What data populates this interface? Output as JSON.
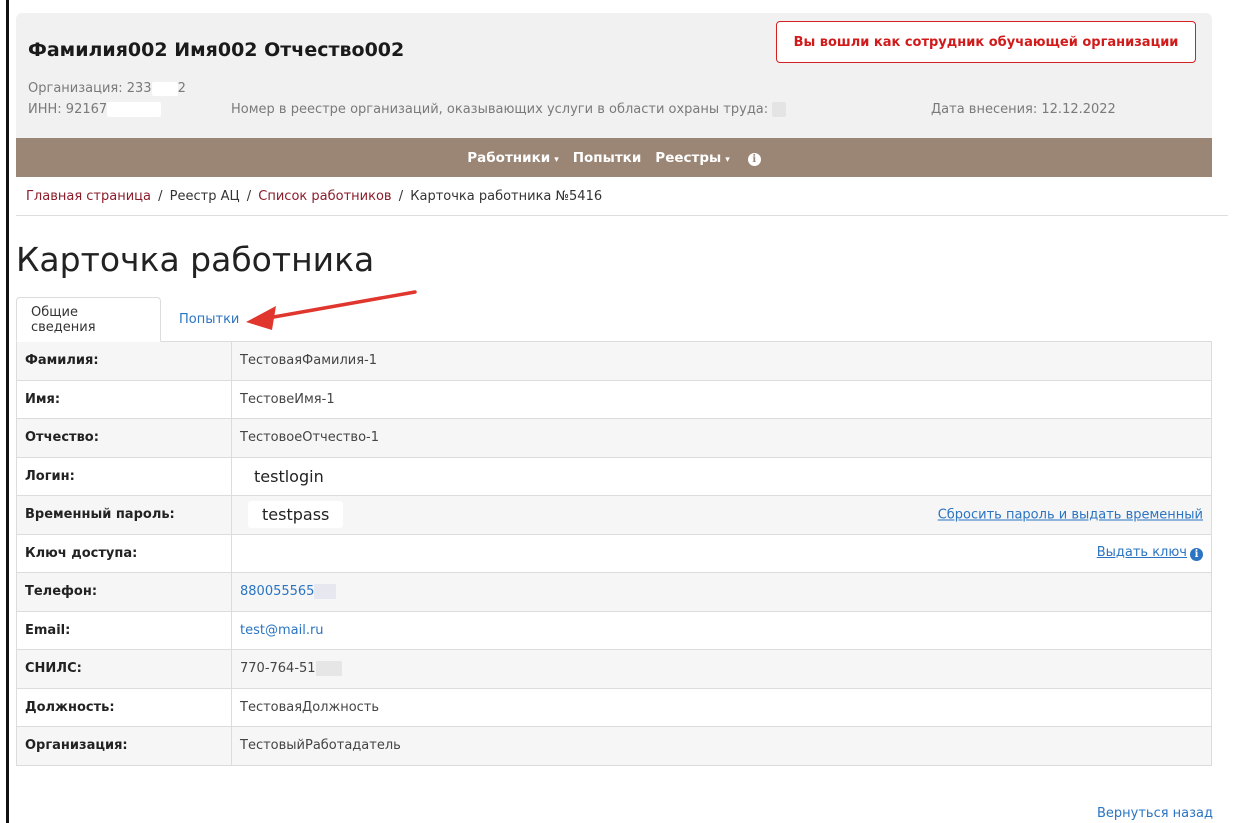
{
  "header": {
    "user_name": "Фамилия002 Имя002 Отчество002",
    "org_label": "Организация:",
    "org_value": "233",
    "org_tail": "2",
    "inn_label": "ИНН:",
    "inn_value": "92167",
    "reestr_label": "Номер в реестре организаций, оказывающих услуги в области охраны труда:",
    "date_label": "Дата внесения:",
    "date_value": "12.12.2022",
    "role_badge": "Вы вошли как сотрудник обучающей организации"
  },
  "nav": {
    "items": [
      {
        "label": "Работники",
        "has_caret": true
      },
      {
        "label": "Попытки",
        "has_caret": false
      },
      {
        "label": "Реестры",
        "has_caret": true
      }
    ],
    "caret_glyph": "▾",
    "info_glyph": "i"
  },
  "breadcrumb": {
    "home": "Главная страница",
    "registry": "Реестр АЦ",
    "employees": "Список работников",
    "current": "Карточка работника №5416",
    "separator": "/"
  },
  "page_title": "Карточка работника",
  "tabs": [
    {
      "label": "Общие сведения",
      "active": true
    },
    {
      "label": "Попытки",
      "active": false
    }
  ],
  "fields": {
    "surname": {
      "label": "Фамилия:",
      "value": "ТестоваяФамилия-1"
    },
    "name": {
      "label": "Имя:",
      "value": "ТестовеИмя-1"
    },
    "patronymic": {
      "label": "Отчество:",
      "value": "ТестовоеОтчество-1"
    },
    "login": {
      "label": "Логин:",
      "value": "testlogin"
    },
    "temp_password": {
      "label": "Временный пароль:",
      "value": "testpass",
      "action": "Сбросить пароль и выдать временный"
    },
    "access_key": {
      "label": "Ключ доступа:",
      "value": "",
      "action": "Выдать ключ"
    },
    "phone": {
      "label": "Телефон:",
      "value": "880055565"
    },
    "email": {
      "label": "Email:",
      "value": "test@mail.ru"
    },
    "snils": {
      "label": "СНИЛС:",
      "value": "770-764-51"
    },
    "position": {
      "label": "Должность:",
      "value": "ТестоваяДолжность"
    },
    "organization": {
      "label": "Организация:",
      "value": "ТестовыйРаботадатель"
    }
  },
  "back_link": "Вернуться назад",
  "colors": {
    "navbar": "#9b8574",
    "link": "#2b74c2",
    "breadcrumb_link": "#8b1c2a",
    "badge": "#d32020",
    "arrow": "#e0362e"
  },
  "icons": {
    "info": "info-circle-icon",
    "arrow": "red-arrow-annotation"
  }
}
